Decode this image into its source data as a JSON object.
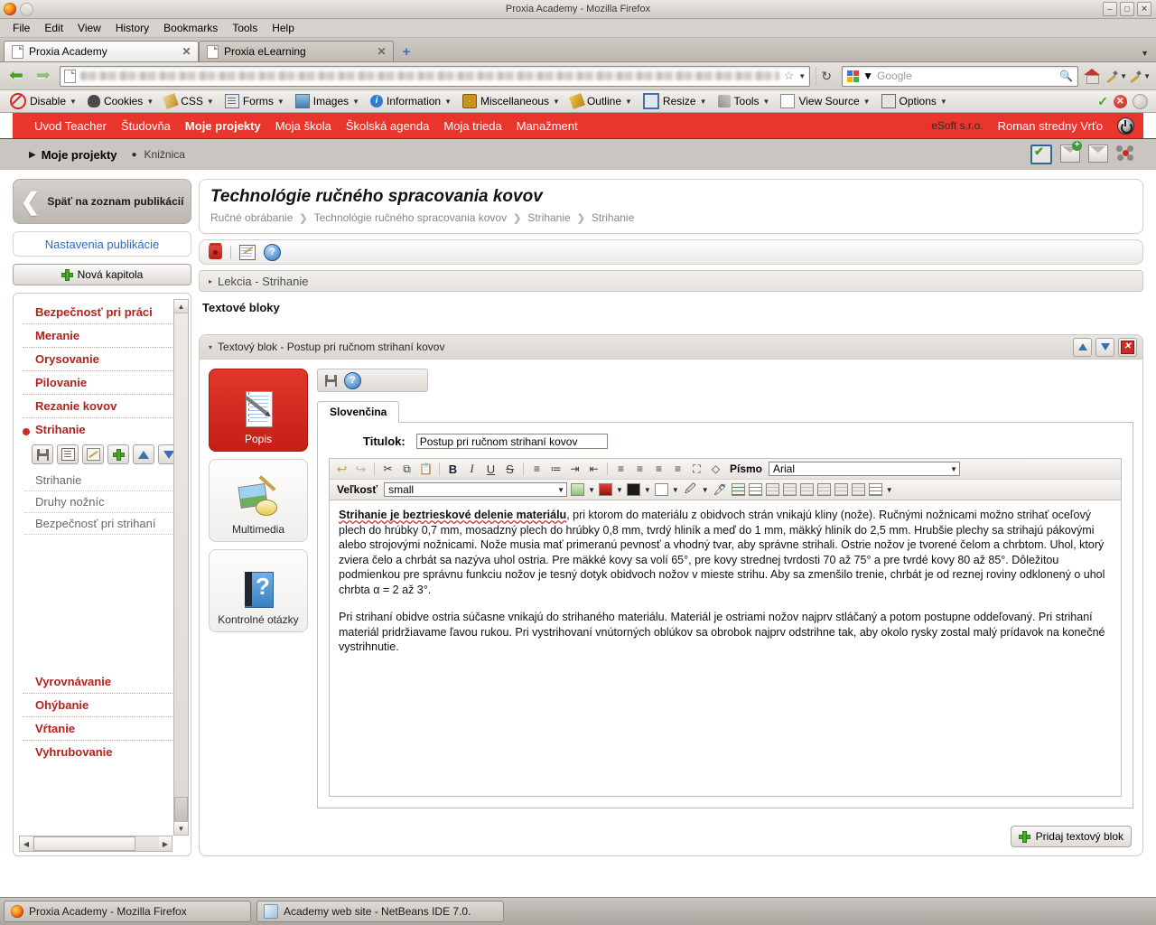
{
  "window": {
    "title": "Proxia Academy - Mozilla Firefox",
    "minimize": "–",
    "maximize": "□",
    "close": "✕"
  },
  "menubar": [
    "File",
    "Edit",
    "View",
    "History",
    "Bookmarks",
    "Tools",
    "Help"
  ],
  "tabs": [
    {
      "label": "Proxia Academy",
      "close": "✕",
      "active": true
    },
    {
      "label": "Proxia eLearning",
      "close": "✕",
      "active": false
    }
  ],
  "newtab_label": "+",
  "navbar": {
    "back": "⬅",
    "forward": "➡",
    "url_value": "",
    "url_placeholder": "",
    "bookmark_star": "☆",
    "reload": "↻",
    "search_placeholder": "Google",
    "search_value": "",
    "search_icon": "🔍",
    "home_title": "Home"
  },
  "devtoolbar": {
    "items": [
      {
        "label": "Disable",
        "icon": "disable-icon"
      },
      {
        "label": "Cookies",
        "icon": "cookies-icon"
      },
      {
        "label": "CSS",
        "icon": "css-icon"
      },
      {
        "label": "Forms",
        "icon": "forms-icon"
      },
      {
        "label": "Images",
        "icon": "images-icon"
      },
      {
        "label": "Information",
        "icon": "information-icon"
      },
      {
        "label": "Miscellaneous",
        "icon": "miscellaneous-icon"
      },
      {
        "label": "Outline",
        "icon": "outline-icon"
      },
      {
        "label": "Resize",
        "icon": "resize-icon"
      },
      {
        "label": "Tools",
        "icon": "tools-icon"
      },
      {
        "label": "View Source",
        "icon": "view-source-icon"
      },
      {
        "label": "Options",
        "icon": "options-icon"
      }
    ],
    "caret": "▼",
    "status_check": "✓",
    "status_error": "✕"
  },
  "appnav": {
    "links": [
      {
        "label": "Uvod Teacher",
        "active": false
      },
      {
        "label": "Študovňa",
        "active": false
      },
      {
        "label": "Moje projekty",
        "active": true
      },
      {
        "label": "Moja škola",
        "active": false
      },
      {
        "label": "Školská agenda",
        "active": false
      },
      {
        "label": "Moja trieda",
        "active": false
      },
      {
        "label": "Manažment",
        "active": false
      }
    ],
    "org": "eSoft s.r.o.",
    "user": "Roman stredny Vrťo"
  },
  "subnav": {
    "triangle": "▶",
    "main": "Moje projekty",
    "dot": "●",
    "sub": "Knižnica",
    "icons": [
      "clipboard-check-icon",
      "mail-add-icon",
      "mail-icon",
      "molecule-icon"
    ]
  },
  "sidebar": {
    "back_button": "Späť na zoznam publikácií",
    "back_chevron": "❮",
    "settings_button": "Nastavenia publikácie",
    "new_chapter_button": "Nová kapitola",
    "chapters": [
      {
        "label": "Bezpečnosť pri práci",
        "selected": false
      },
      {
        "label": "Meranie",
        "selected": false
      },
      {
        "label": "Orysovanie",
        "selected": false
      },
      {
        "label": "Pilovanie",
        "selected": false
      },
      {
        "label": "Rezanie kovov",
        "selected": false
      },
      {
        "label": "Strihanie",
        "selected": true
      }
    ],
    "chapter_tools": [
      "save-icon",
      "list-icon",
      "edit-icon",
      "add-icon",
      "move-up-icon",
      "move-down-icon"
    ],
    "lessons": [
      "Strihanie",
      "Druhy nožníc",
      "Bezpečnosť pri strihaní"
    ],
    "chapters_after": [
      {
        "label": "Vyrovnávanie"
      },
      {
        "label": "Ohýbanie"
      },
      {
        "label": "Vŕtanie"
      },
      {
        "label": "Vyhrubovanie"
      }
    ],
    "scroll_up": "▲",
    "scroll_down": "▼",
    "scroll_left": "◀",
    "scroll_right": "▶"
  },
  "publication": {
    "title": "Technológie ručného spracovania kovov",
    "breadcrumb": [
      "Ručné obrábanie",
      "Technológie ručného spracovania kovov",
      "Strihanie",
      "Strihanie"
    ],
    "breadcrumb_sep": "❯"
  },
  "toolcard": {
    "icons": [
      "trash-icon",
      "note-edit-icon",
      "help-icon"
    ],
    "help_glyph": "?"
  },
  "lesson_bar": {
    "triangle": "▸",
    "label": "Lekcia - Strihanie"
  },
  "section_heading": "Textové bloky",
  "block": {
    "triangle": "▾",
    "title": "Textový blok - Postup pri ručnom strihaní kovov",
    "actions": [
      "move-up-icon",
      "move-down-icon",
      "delete-icon"
    ],
    "delete_glyph": "✕"
  },
  "modes": [
    {
      "label": "Popis",
      "icon": "description-icon",
      "active": true
    },
    {
      "label": "Multimedia",
      "icon": "multimedia-icon",
      "active": false
    },
    {
      "label": "Kontrolné otázky",
      "icon": "quiz-icon",
      "active": false
    }
  ],
  "editor": {
    "toolbar_icons": [
      "save-icon",
      "help-icon"
    ],
    "help_glyph": "?",
    "language_tab": "Slovenčina",
    "title_label": "Titulok:",
    "title_value": "Postup pri ručnom strihaní kovov",
    "rte": {
      "undo": "↩",
      "redo": "↪",
      "cut": "✂",
      "copy": "⧉",
      "paste": "📋",
      "bold": "B",
      "italic": "I",
      "underline": "U",
      "strike": "S",
      "ordered_list": "≡",
      "unordered_list": "≔",
      "indent": "⇥",
      "outdent": "⇤",
      "align_left": "≡",
      "align_center": "≡",
      "align_right": "≡",
      "align_justify": "≡",
      "fullscreen": "⛶",
      "source": "◇",
      "font_label": "Písmo",
      "font_value": "Arial",
      "size_label": "Veľkosť",
      "size_value": "small",
      "image_icon": "image-icon",
      "flash_icon": "flash-icon",
      "media_icon": "media-icon",
      "audio_icon": "audio-icon",
      "link_icon": "link-icon",
      "unlink_icon": "unlink-icon",
      "table_icon": "table-icon",
      "table_props_icon": "table-properties-icon",
      "caret": "▼"
    },
    "content": {
      "p1_bold": "Strihanie je beztrieskové delenie materiálu",
      "p1_rest": ", pri ktorom do materiálu z obidvoch strán vnikajú kliny (nože). Ručnými nožnicami možno strihať oceľový plech do hrúbky 0,7 mm, mosadzný plech do hrúbky 0,8 mm, tvrdý hliník a meď do 1 mm, mäkký hliník do 2,5 mm. Hrubšie plechy sa strihajú pákovými alebo strojovými nožnicami. Nože musia mať primeranú pevnosť a vhodný tvar, aby správne strihali. Ostrie nožov je tvorené čelom a chrbtom. Uhol, ktorý zviera čelo a chrbát sa nazýva uhol ostria. Pre mäkké kovy sa volí 65°, pre kovy strednej tvrdosti 70 až 75° a pre tvrdé kovy 80 až 85°. Dôležitou podmienkou pre správnu funkciu nožov je tesný dotyk obidvoch nožov v mieste strihu. Aby sa zmenšilo trenie, chrbát je od reznej roviny odklonený o uhol chrbta α = 2 až 3°.",
      "p2": "Pri strihaní obidve ostria súčasne vnikajú do strihaného materiálu. Materiál je ostriami nožov najprv stláčaný a potom postupne oddeľovaný. Pri strihaní materiál pridržiavame ľavou rukou. Pri vystrihovaní vnútorných oblúkov sa obrobok najprv odstrihne tak, aby okolo rysky zostal malý prídavok na konečné vystrihnutie."
    }
  },
  "add_block_button": "Pridaj textový blok",
  "taskbar": [
    {
      "label": "Proxia Academy - Mozilla Firefox",
      "icon": "firefox-icon"
    },
    {
      "label": "Academy web site - NetBeans IDE 7.0.",
      "icon": "netbeans-icon"
    }
  ],
  "colors": {
    "brand_red": "#e8362c",
    "chapter_red": "#b3211d",
    "link_blue": "#2a6ebb",
    "chrome_grey": "#d6d2cd"
  }
}
